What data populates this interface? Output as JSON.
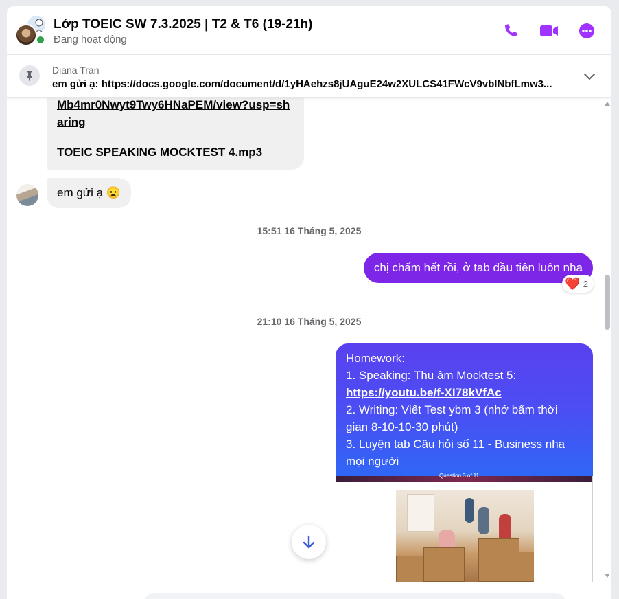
{
  "header": {
    "title": "Lớp TOEIC SW 7.3.2025 | T2 & T6 (19-21h)",
    "status": "Đang hoạt động",
    "accent": "#a033ff"
  },
  "pinned": {
    "sender": "Diana Tran",
    "text": "em gửi ạ: https://docs.google.com/document/d/1yHAehzs8jUAguE24w2XULCS41FWcV9vbINbfLmw3..."
  },
  "messages": {
    "file_link": "Mb4mr0Nwyt9Twy6HNaPEM/view?usp=sharing",
    "file_name": "TOEIC SPEAKING MOCKTEST 4.mp3",
    "em_gui": "em gửi ạ 😦",
    "timestamp1": "15:51 16 Tháng 5, 2025",
    "outgoing1": "chị chấm hết rồi, ở tab đầu tiên luôn nha",
    "reaction_emoji": "❤️",
    "reaction_count": "2",
    "timestamp2": "21:10 16 Tháng 5, 2025",
    "homework": {
      "l1": "Homework:",
      "l2": "1. Speaking: Thu âm Mocktest 5:",
      "link": "https://youtu.be/f-XI78kVfAc",
      "l3": "2. Writing: Viết Test ybm 3 (nhớ bấm thời gian 8-10-10-30 phút)",
      "l4": "3. Luyện tab Câu hỏi số 11 - Business nha mọi người"
    },
    "image_caption": "Question 3 of 11"
  },
  "colors": {
    "outgoing_purple": "#7e26e8",
    "homework_gradient_top": "#5a41f0",
    "homework_gradient_bottom": "#2f67f6",
    "incoming_bg": "#f0f0f0"
  },
  "icons": [
    "phone-icon",
    "video-icon",
    "more-icon",
    "pin-icon",
    "chevron-down-icon",
    "arrow-down-icon",
    "heart-icon"
  ]
}
